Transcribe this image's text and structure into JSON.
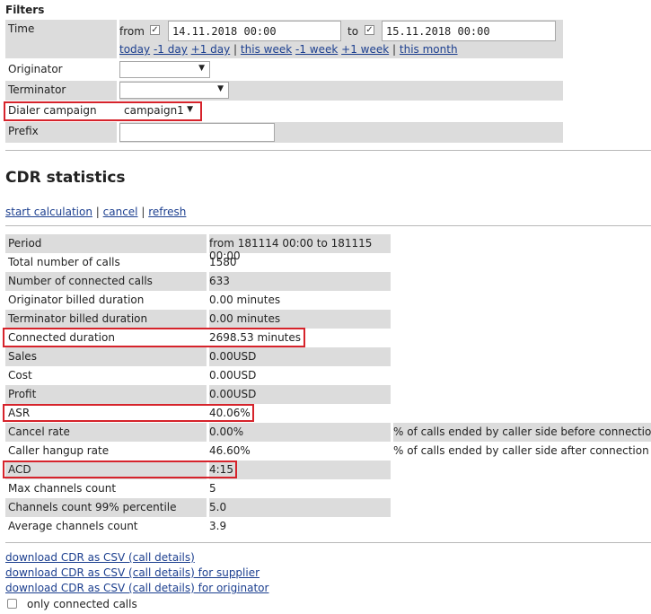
{
  "filters": {
    "title": "Filters",
    "time": {
      "label": "Time",
      "from_label": "from",
      "from_value": "14.11.2018 00:00",
      "to_label": "to",
      "to_value": "15.11.2018 00:00",
      "quick": [
        "today",
        "-1 day",
        "+1 day",
        "this week",
        "-1 week",
        "+1 week",
        "this month"
      ]
    },
    "originator": {
      "label": "Originator",
      "value": ""
    },
    "terminator": {
      "label": "Terminator",
      "value": ""
    },
    "dialer_campaign": {
      "label": "Dialer campaign",
      "value": "campaign1"
    },
    "prefix": {
      "label": "Prefix",
      "value": ""
    }
  },
  "cdr": {
    "title": "CDR statistics",
    "actions": [
      "start calculation",
      "cancel",
      "refresh"
    ],
    "rows": [
      {
        "label": "Period",
        "value": "from 181114 00:00 to 181115 00:00",
        "note": ""
      },
      {
        "label": "Total number of calls",
        "value": "1580",
        "note": ""
      },
      {
        "label": "Number of connected calls",
        "value": "633",
        "note": ""
      },
      {
        "label": "Originator billed duration",
        "value": "0.00 minutes",
        "note": ""
      },
      {
        "label": "Terminator billed duration",
        "value": "0.00 minutes",
        "note": ""
      },
      {
        "label": "Connected duration",
        "value": "2698.53 minutes",
        "note": ""
      },
      {
        "label": "Sales",
        "value": "0.00USD",
        "note": ""
      },
      {
        "label": "Cost",
        "value": "0.00USD",
        "note": ""
      },
      {
        "label": "Profit",
        "value": "0.00USD",
        "note": ""
      },
      {
        "label": "ASR",
        "value": "40.06%",
        "note": ""
      },
      {
        "label": "Cancel rate",
        "value": "0.00%",
        "note": "% of calls ended by caller side before connection"
      },
      {
        "label": "Caller hangup rate",
        "value": "46.60%",
        "note": "% of calls ended by caller side after connection"
      },
      {
        "label": "ACD",
        "value": "4:15",
        "note": ""
      },
      {
        "label": "Max channels count",
        "value": "5",
        "note": ""
      },
      {
        "label": "Channels count 99% percentile",
        "value": "5.0",
        "note": ""
      },
      {
        "label": "Average channels count",
        "value": "3.9",
        "note": ""
      }
    ]
  },
  "downloads": [
    "download CDR as CSV (call details)",
    "download CDR as CSV (call details) for supplier",
    "download CDR as CSV (call details) for originator"
  ],
  "only_connected": {
    "label": "only connected calls",
    "checked": false
  },
  "colors": {
    "highlight": "#d6232b",
    "row_gray": "#dcdcdc",
    "link": "#1c3f8f"
  }
}
